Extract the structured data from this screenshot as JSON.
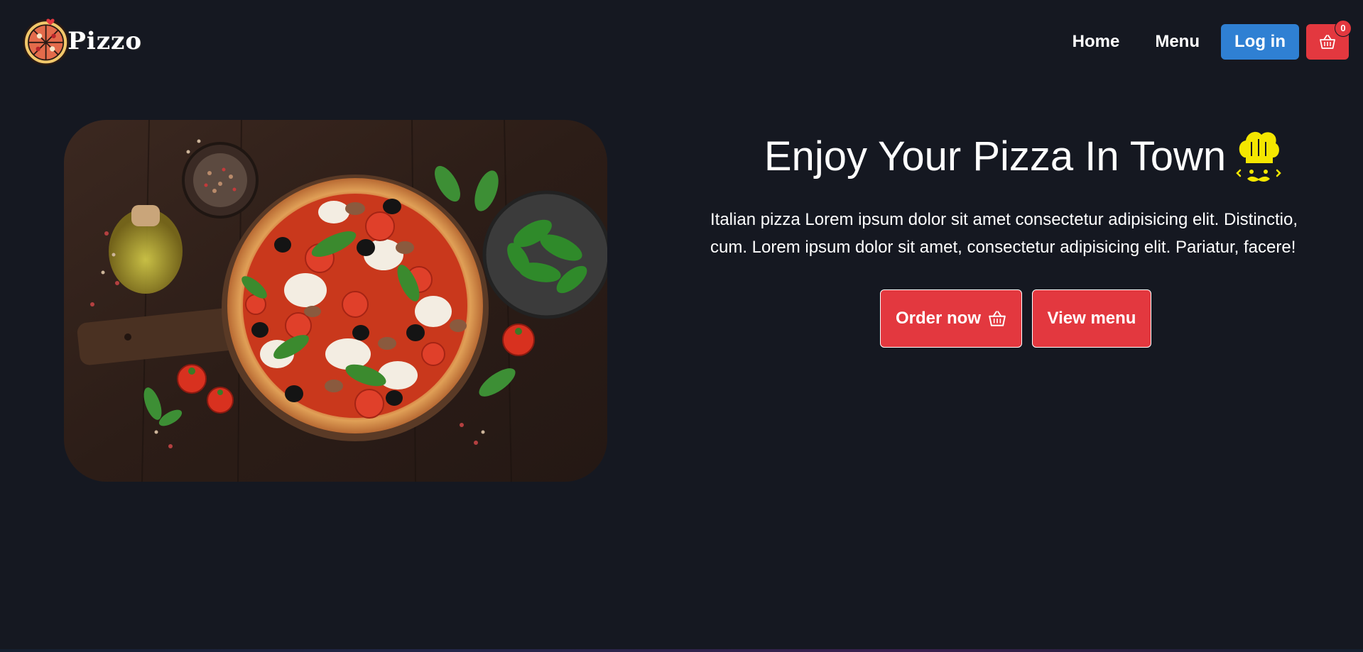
{
  "header": {
    "logo_text": "Pizzo",
    "nav": {
      "home_label": "Home",
      "menu_label": "Menu",
      "login_label": "Log in",
      "cart_count": "0"
    }
  },
  "hero": {
    "title": "Enjoy Your Pizza In Town",
    "description": "Italian pizza Lorem ipsum dolor sit amet consectetur adipisicing elit. Distinctio, cum. Lorem ipsum dolor sit amet, consectetur adipisicing elit. Pariatur, facere!",
    "order_button_label": "Order now",
    "view_menu_button_label": "View menu"
  },
  "icons": {
    "logo": "pizza-icon",
    "cart": "basket-icon",
    "chef": "chef-hat-icon"
  },
  "colors": {
    "background": "#151821",
    "accent_red": "#e3383f",
    "login_blue": "#2f80d3",
    "chef_yellow": "#f4e600"
  }
}
